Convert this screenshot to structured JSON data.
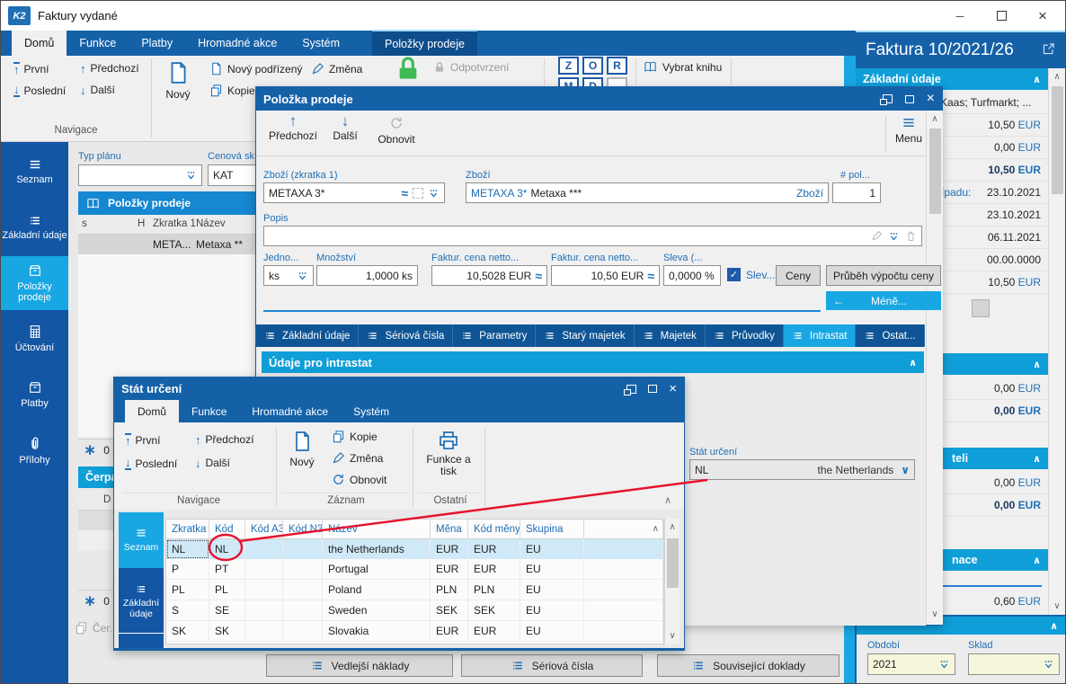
{
  "win": {
    "title": "Faktury vydané",
    "logo": "K2"
  },
  "icons": {
    "up": "∧",
    "down": "∨",
    "left": "←",
    "ua": "↑",
    "da": "↓",
    "check": "✓",
    "x": "×",
    "min": "─",
    "tilde": "≈",
    "ast": "∗"
  },
  "tabs": {
    "domu": "Domů",
    "funkce": "Funkce",
    "platby": "Platby",
    "hromadne": "Hromadné akce",
    "system": "Systém",
    "polozky": "Položky prodeje"
  },
  "ribbon": {
    "prvni": "První",
    "predchozi": "Předchozí",
    "posledni": "Poslední",
    "dalsi": "Další",
    "novy": "Nový",
    "novy_podrizeny": "Nový podřízený",
    "kopie": "Kopie",
    "zmena": "Změna",
    "odpotvrzeni": "Odpotvrzení",
    "z": "Z",
    "o": "O",
    "r": "R",
    "m": "M",
    "d": "D",
    "vybrat": "Vybrat knihu",
    "navigace": "Navigace"
  },
  "sidebar": {
    "seznam": "Seznam",
    "zakladni": "Základní údaje",
    "polozky": "Položky prodeje",
    "uctovani": "Účtování",
    "platby": "Platby",
    "prilohy": "Přílohy"
  },
  "content": {
    "typ_planu": "Typ plánu",
    "cenova": "Cenová sk...",
    "kat": "KAT",
    "hdr": "Položky prodeje",
    "col_s": "s",
    "col_h": "H",
    "col_zk": "Zkratka 1",
    "col_naz": "Název",
    "r_zk": "META...",
    "r_naz": "Metaxa **",
    "cnt": "0",
    "cerpani": "Čerpání",
    "col_d": "D",
    "cnt2": "0",
    "cer": "Čer...",
    "b1": "Vedlejší náklady",
    "b2": "Sériová čísla",
    "b3": "Související doklady"
  },
  "invoice": {
    "title": "Faktura 10/2021/26",
    "sec1": "Základní údaje",
    "address": "Kaas; Turfmarkt; ...",
    "cur": "EUR",
    "m1": "10,50",
    "m2": "0,00",
    "m3": "10,50",
    "m4": "10,50",
    "pripadu": "řípadu:",
    "d1": "23.10.2021",
    "d2": "23.10.2021",
    "d3": "06.11.2021",
    "d4": "00.00.0000",
    "s2m1": "0,00",
    "s2m2": "0,00",
    "s3frag": "teli",
    "s3m1": "0,00",
    "s3m2": "0,00",
    "s4frag": "nace",
    "s4m": "0,60",
    "obdobi": "Období",
    "obdobi_val": "2021",
    "sklad": "Sklad"
  },
  "idlg": {
    "title": "Položka prodeje",
    "predchozi": "Předchozí",
    "dalsi": "Další",
    "obnovit": "Obnovit",
    "menu": "Menu",
    "l1": "Zboží (zkratka 1)",
    "v1": "METAXA 3*",
    "l2": "Zboží",
    "v2a": "METAXA 3*",
    "v2b": "Metaxa ***",
    "link": "Zboží",
    "l3": "# pol...",
    "v3": "1",
    "popis": "Popis",
    "jedno": "Jedno...",
    "jedno_v": "ks",
    "mnoz": "Množství",
    "mnoz_v": "1,0000 ks",
    "c1l": "Faktur. cena netto...",
    "c1": "10,5028 EUR",
    "c2l": "Faktur. cena netto...",
    "c2": "10,50 EUR",
    "sl": "Sleva (...",
    "slv": "0,0000 %",
    "chk": "Slev...",
    "ceny": "Ceny",
    "prubeh": "Průběh výpočtu ceny",
    "mene": "Méně...",
    "tabs": [
      "Základní údaje",
      "Sériová čísla",
      "Parametry",
      "Starý majetek",
      "Majetek",
      "Průvodky",
      "Intrastat",
      "Ostat..."
    ],
    "hdr": "Údaje pro intrastat",
    "stat": "Stát určení",
    "statc": "NL",
    "statn": "the Netherlands"
  },
  "sdlg": {
    "title": "Stát určení",
    "tabs": [
      "Domů",
      "Funkce",
      "Hromadné akce",
      "Systém"
    ],
    "prvni": "První",
    "predchozi": "Předchozí",
    "posledni": "Poslední",
    "dalsi": "Další",
    "novy": "Nový",
    "kopie": "Kopie",
    "zmena": "Změna",
    "obnovit": "Obnovit",
    "ftisk": "Funkce a tisk",
    "g1": "Navigace",
    "g2": "Záznam",
    "g3": "Ostatní",
    "seznam": "Seznam",
    "zakladni": "Základní údaje",
    "cols": [
      "Zkratka",
      "Kód",
      "Kód A3",
      "Kód N3",
      "Název",
      "Měna",
      "Kód měny",
      "Skupina"
    ],
    "rows": [
      [
        "NL",
        "NL",
        "",
        "",
        "the Netherlands",
        "EUR",
        "EUR",
        "EU"
      ],
      [
        "P",
        "PT",
        "",
        "",
        "Portugal",
        "EUR",
        "EUR",
        "EU"
      ],
      [
        "PL",
        "PL",
        "",
        "",
        "Poland",
        "PLN",
        "PLN",
        "EU"
      ],
      [
        "S",
        "SE",
        "",
        "",
        "Sweden",
        "SEK",
        "SEK",
        "EU"
      ],
      [
        "SK",
        "SK",
        "",
        "",
        "Slovakia",
        "EUR",
        "EUR",
        "EU"
      ]
    ]
  },
  "colors": {
    "ribbon": "#1561a8",
    "accent": "#18a7e3",
    "header": "#0f9ed8",
    "annotation": "#e8112d"
  }
}
